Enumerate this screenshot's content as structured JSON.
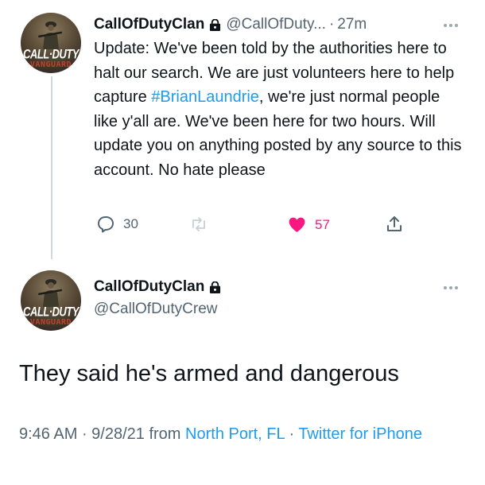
{
  "reply_tweet": {
    "avatar": {
      "logo_main": "CALL·DUTY",
      "logo_sub": "VANGUARD"
    },
    "display_name": "CallOfDutyClan",
    "handle": "@CallOfDuty...",
    "separator": "·",
    "time": "27m",
    "text_before_hashtag": "Update: We've been told by the authorities here to halt our search. We are just volunteers here to help capture ",
    "hashtag": "#BrianLaundrie",
    "text_after_hashtag": ", we're just normal people like y'all are. We've been here for two hours. Will update you on anything posted by any source to this account. No hate please",
    "actions": {
      "reply_count": "30",
      "retweet_count": "",
      "like_count": "57"
    }
  },
  "main_tweet": {
    "avatar": {
      "logo_main": "CALL·DUTY",
      "logo_sub": "VANGUARD"
    },
    "display_name": "CallOfDutyClan",
    "handle": "@CallOfDutyCrew",
    "text": "They said he's armed and dangerous",
    "meta": {
      "time": "9:46 AM",
      "sep1": " · ",
      "date": "9/28/21",
      "from_label": " from ",
      "location": "North Port, FL",
      "sep2": " · ",
      "source": "Twitter for iPhone"
    }
  },
  "colors": {
    "link": "#1d9bf0",
    "muted": "#536471",
    "like": "#f91880",
    "text": "#0f1419"
  },
  "icons": [
    "lock-icon",
    "more-icon",
    "reply-icon",
    "retweet-icon",
    "heart-icon",
    "share-icon",
    "soldier-icon"
  ]
}
